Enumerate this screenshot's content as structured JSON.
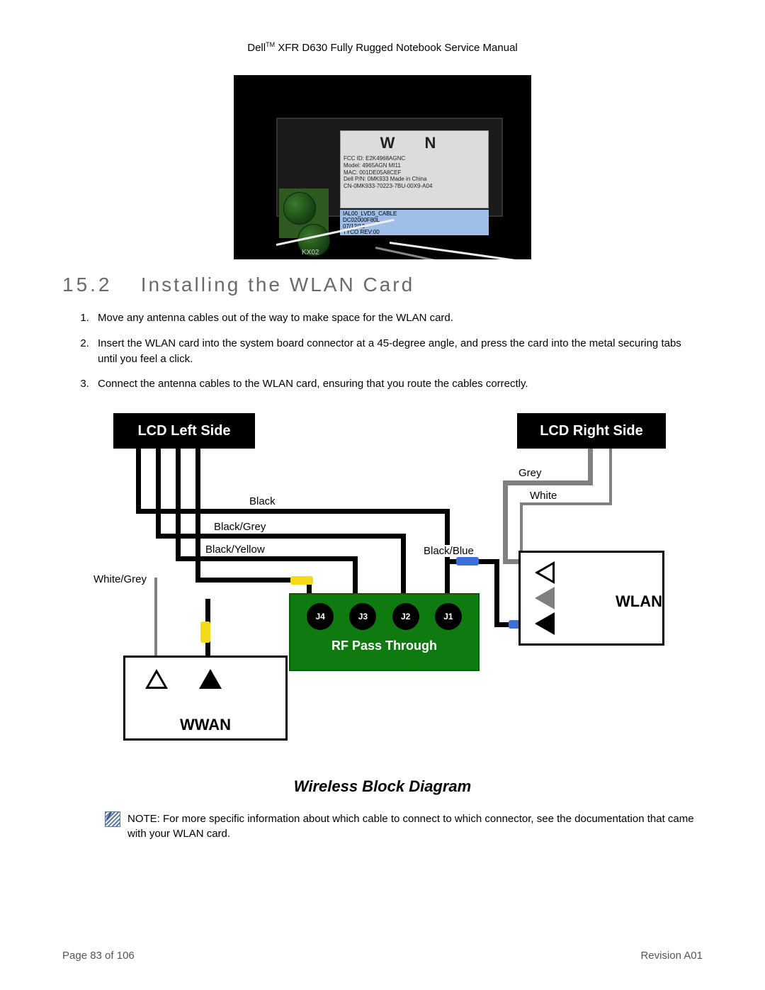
{
  "header": {
    "brand": "Dell",
    "trademark": "TM",
    "rest": " XFR D630 Fully Rugged Notebook Service Manual"
  },
  "photo": {
    "big_letters": "W  N",
    "fcc": "FCC ID: E2K4968AGNC",
    "model": "Model: 4965AGN MI11",
    "mac": "MAC: 001DE05A8CEF",
    "pn": "Dell P/N: 0MK933    Made in China",
    "cn": "CN-0MK933-70223-7BU-00X9-A04",
    "strip1": "IAL00_LVDS_CABLE",
    "strip2": "DC02000F80L",
    "strip3": "07/12/13",
    "strip4": "TYCO REV:00",
    "kx": "KX02"
  },
  "section": {
    "number": "15.2",
    "title": "Installing the WLAN Card"
  },
  "steps": [
    "Move any antenna cables out of the way to make space for the WLAN card.",
    "Insert the WLAN card into the system board connector at a 45-degree angle, and press the card into the metal securing tabs until you feel a click.",
    "Connect the antenna cables to the WLAN card, ensuring that you route the cables correctly."
  ],
  "diagram": {
    "lcd_left": "LCD Left Side",
    "lcd_right": "LCD Right Side",
    "rf_title": "RF Pass Through",
    "jacks": [
      "J4",
      "J3",
      "J2",
      "J1"
    ],
    "wwan": "WWAN",
    "wlan": "WLAN",
    "labels": {
      "black": "Black",
      "black_grey": "Black/Grey",
      "black_yellow": "Black/Yellow",
      "white_grey": "White/Grey",
      "grey": "Grey",
      "white": "White",
      "black_blue": "Black/Blue"
    },
    "caption": "Wireless Block Diagram"
  },
  "note": {
    "text": "NOTE: For more specific information about which cable to connect to which connector, see the documentation that came with your WLAN card."
  },
  "footer": {
    "page": "Page 83 of 106",
    "revision": "Revision A01"
  }
}
